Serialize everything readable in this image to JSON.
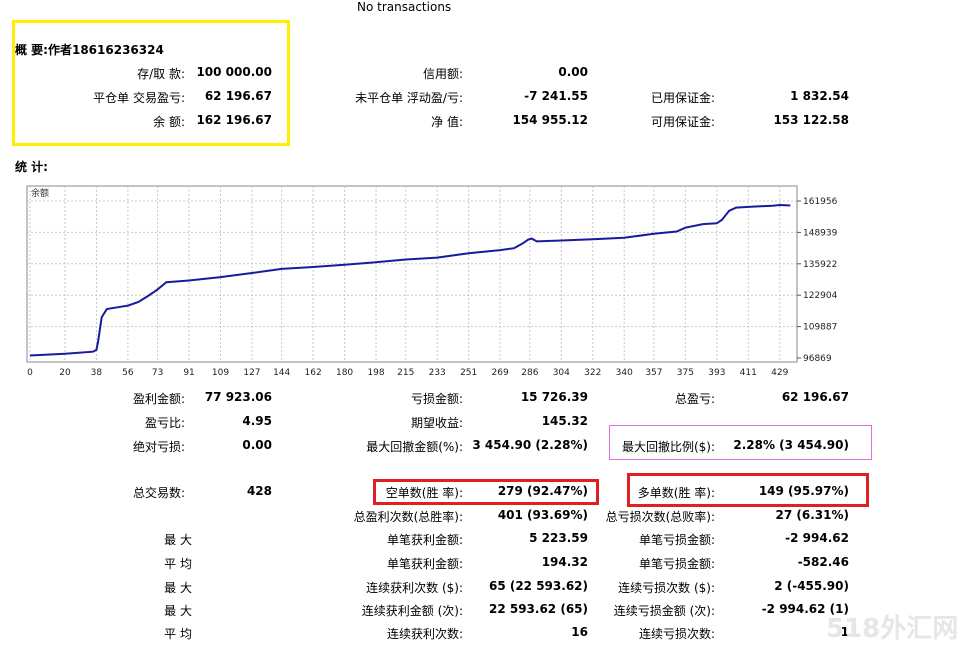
{
  "top_notice": "No transactions",
  "summary": {
    "title": "概 要:作者18616236324",
    "rows": [
      [
        "存/取 款:",
        "100 000.00",
        "信用额:",
        "0.00",
        "",
        ""
      ],
      [
        "平仓单 交易盈亏:",
        "62 196.67",
        "未平仓单 浮动盈/亏:",
        "-7 241.55",
        "已用保证金:",
        "1 832.54"
      ],
      [
        "余 额:",
        "162 196.67",
        "净 值:",
        "154 955.12",
        "可用保证金:",
        "153 122.58"
      ]
    ]
  },
  "stats_title": "统 计:",
  "chart_data": {
    "type": "line",
    "series_label": "余额",
    "x_ticks": [
      0,
      20,
      38,
      56,
      73,
      91,
      109,
      127,
      144,
      162,
      180,
      198,
      215,
      233,
      251,
      269,
      286,
      304,
      322,
      340,
      357,
      375,
      393,
      411,
      429
    ],
    "y_ticks": [
      96869,
      109887,
      122904,
      135922,
      148939,
      161956
    ],
    "ylim": [
      96869,
      161956
    ],
    "xlim": [
      0,
      436
    ],
    "line_color": "#1a1a9c",
    "points": [
      [
        0,
        97900
      ],
      [
        20,
        98600
      ],
      [
        36,
        99500
      ],
      [
        38,
        100200
      ],
      [
        39,
        104000
      ],
      [
        41,
        113800
      ],
      [
        44,
        117200
      ],
      [
        50,
        117900
      ],
      [
        56,
        118600
      ],
      [
        62,
        120100
      ],
      [
        68,
        122800
      ],
      [
        73,
        125300
      ],
      [
        78,
        128300
      ],
      [
        91,
        129000
      ],
      [
        109,
        130400
      ],
      [
        127,
        132100
      ],
      [
        144,
        133800
      ],
      [
        162,
        134600
      ],
      [
        180,
        135500
      ],
      [
        198,
        136600
      ],
      [
        215,
        137700
      ],
      [
        233,
        138500
      ],
      [
        251,
        140300
      ],
      [
        269,
        141600
      ],
      [
        277,
        142400
      ],
      [
        282,
        144400
      ],
      [
        285,
        145900
      ],
      [
        287,
        146400
      ],
      [
        290,
        145200
      ],
      [
        304,
        145600
      ],
      [
        322,
        146100
      ],
      [
        340,
        146700
      ],
      [
        357,
        148400
      ],
      [
        370,
        149300
      ],
      [
        375,
        150900
      ],
      [
        385,
        152400
      ],
      [
        393,
        152700
      ],
      [
        396,
        154200
      ],
      [
        400,
        157900
      ],
      [
        404,
        159200
      ],
      [
        411,
        159500
      ],
      [
        425,
        160000
      ],
      [
        429,
        160300
      ],
      [
        435,
        160100
      ]
    ]
  },
  "stats": {
    "rows": [
      [
        "盈利金额:",
        "77 923.06",
        "亏损金额:",
        "15 726.39",
        "总盈亏:",
        "62 196.67"
      ],
      [
        "盈亏比:",
        "4.95",
        "期望收益:",
        "145.32",
        "",
        ""
      ],
      [
        "绝对亏损:",
        "0.00",
        "最大回撤金额(%):",
        "3 454.90 (2.28%)",
        "最大回撤比例($):",
        "2.28% (3 454.90)"
      ],
      [
        "总交易数:",
        "428",
        "空单数(胜 率):",
        "279 (92.47%)",
        "多单数(胜 率):",
        "149 (95.97%)"
      ],
      [
        "",
        "",
        "总盈利次数(总胜率):",
        "401 (93.69%)",
        "总亏损次数(总败率):",
        "27 (6.31%)"
      ],
      [
        "最 大",
        "",
        "单笔获利金额:",
        "5 223.59",
        "单笔亏损金额:",
        "-2 994.62"
      ],
      [
        "平 均",
        "",
        "单笔获利金额:",
        "194.32",
        "单笔亏损金额:",
        "-582.46"
      ],
      [
        "最 大",
        "",
        "连续获利次数 ($):",
        "65 (22 593.62)",
        "连续亏损次数 ($):",
        "2 (-455.90)"
      ],
      [
        "最 大",
        "",
        "连续获利金额 (次):",
        "22 593.62 (65)",
        "连续亏损金额 (次):",
        "-2 994.62 (1)"
      ],
      [
        "平 均",
        "",
        "连续获利次数:",
        "16",
        "连续亏损次数:",
        "1"
      ]
    ]
  },
  "watermark": "518外汇网",
  "colors": {
    "yellow_box": "#ffee00",
    "red_box": "#e02020",
    "magenta_box": "#e070e0"
  }
}
